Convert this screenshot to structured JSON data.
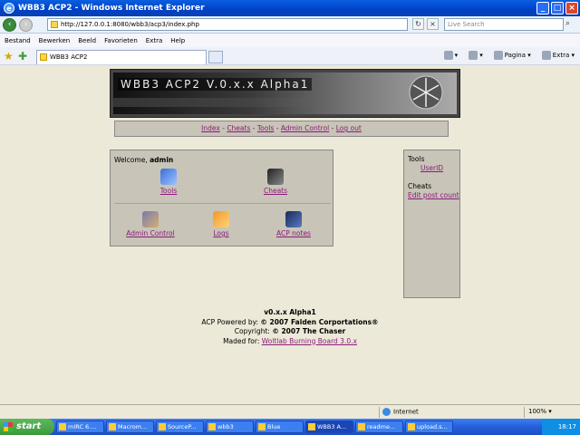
{
  "window": {
    "title": "WBB3 ACP2 - Windows Internet Explorer"
  },
  "addressbar": {
    "url": "http://127.0.0.1:8080/wbb3/acp3/index.php",
    "search_placeholder": "Live Search"
  },
  "menubar": {
    "items": [
      "Bestand",
      "Bewerken",
      "Beeld",
      "Favorieten",
      "Extra",
      "Help"
    ]
  },
  "tab": {
    "label": "WBB3 ACP2"
  },
  "commandbar": {
    "page_label": "Pagina",
    "extra_label": "Extra"
  },
  "banner": {
    "title": "WBB3 ACP2 V.0.x.x Alpha1"
  },
  "nav": {
    "links": [
      "Index",
      "Cheats",
      "Tools",
      "Admin Control",
      "Log out"
    ],
    "separator": "-"
  },
  "welcome": {
    "prefix": "Welcome,",
    "user": "admin",
    "items": [
      {
        "label": "Tools",
        "icon": "tools-icon"
      },
      {
        "label": "Cheats",
        "icon": "cheats-icon"
      },
      {
        "label": "Admin Control",
        "icon": "admin-control-icon"
      },
      {
        "label": "Logs",
        "icon": "logs-icon"
      },
      {
        "label": "ACP notes",
        "icon": "acp-notes-icon"
      }
    ]
  },
  "sidebar": {
    "tools_heading": "Tools",
    "tools_link": "UserID",
    "cheats_heading": "Cheats",
    "cheats_link": "Edit post count"
  },
  "footer": {
    "version": "v0.x.x Alpha1",
    "powered_prefix": "ACP Powered by:",
    "powered_value": "© 2007 Falden Corportations®",
    "copyright_prefix": "Copyright:",
    "copyright_value": "© 2007 The Chaser",
    "made_prefix": "Maded for:",
    "made_link": "Woltlab Burning Board 3.0.x"
  },
  "statusbar": {
    "zone": "Internet",
    "zoom": "100%"
  },
  "taskbar": {
    "start": "start",
    "tasks": [
      "mIRC 6....",
      "Macrom...",
      "SourceP...",
      "wbb3",
      "Blue",
      "WBB3 A...",
      "readme...",
      "upload.s..."
    ],
    "active_index": 5,
    "clock": "18:17"
  }
}
